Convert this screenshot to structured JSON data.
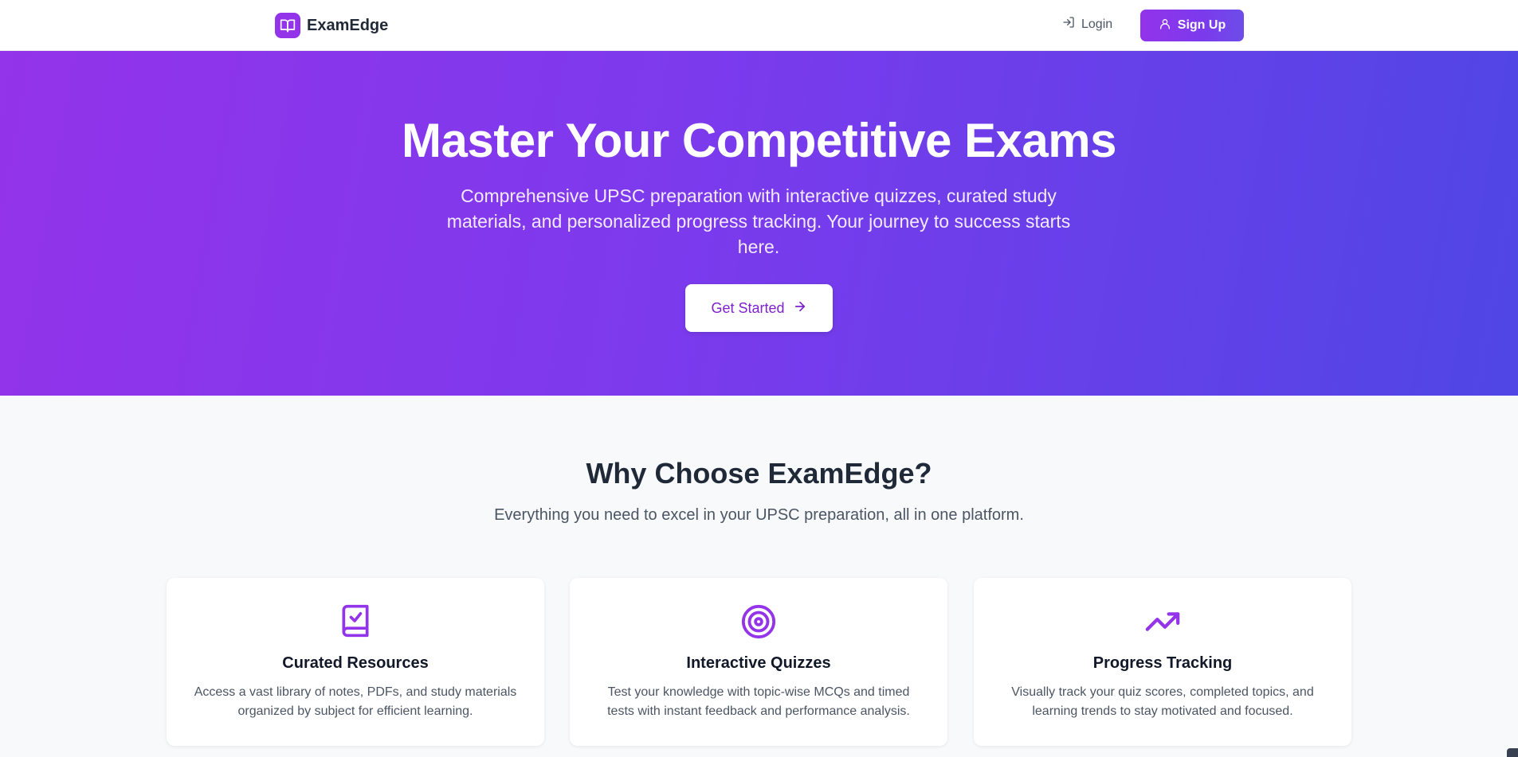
{
  "header": {
    "brand_name": "ExamEdge",
    "brand_icon": "book-open-icon",
    "login_label": "Login",
    "signup_label": "Sign Up"
  },
  "hero": {
    "title": "Master Your Competitive Exams",
    "subtitle": "Comprehensive UPSC preparation with interactive quizzes, curated study materials, and personalized progress tracking. Your journey to success starts here.",
    "cta_label": "Get Started"
  },
  "features": {
    "title": "Why Choose ExamEdge?",
    "subtitle": "Everything you need to excel in your UPSC preparation, all in one platform.",
    "cards": [
      {
        "icon": "book-check-icon",
        "title": "Curated Resources",
        "description": "Access a vast library of notes, PDFs, and study materials organized by subject for efficient learning."
      },
      {
        "icon": "target-icon",
        "title": "Interactive Quizzes",
        "description": "Test your knowledge with topic-wise MCQs and timed tests with instant feedback and performance analysis."
      },
      {
        "icon": "trending-up-icon",
        "title": "Progress Tracking",
        "description": "Visually track your quiz scores, completed topics, and learning trends to stay motivated and focused."
      }
    ]
  },
  "colors": {
    "primary": "#9333ea",
    "secondary": "#4f46e5",
    "background": "#f8f9fb",
    "text_dark": "#1f2937",
    "text_muted": "#4b5563"
  }
}
